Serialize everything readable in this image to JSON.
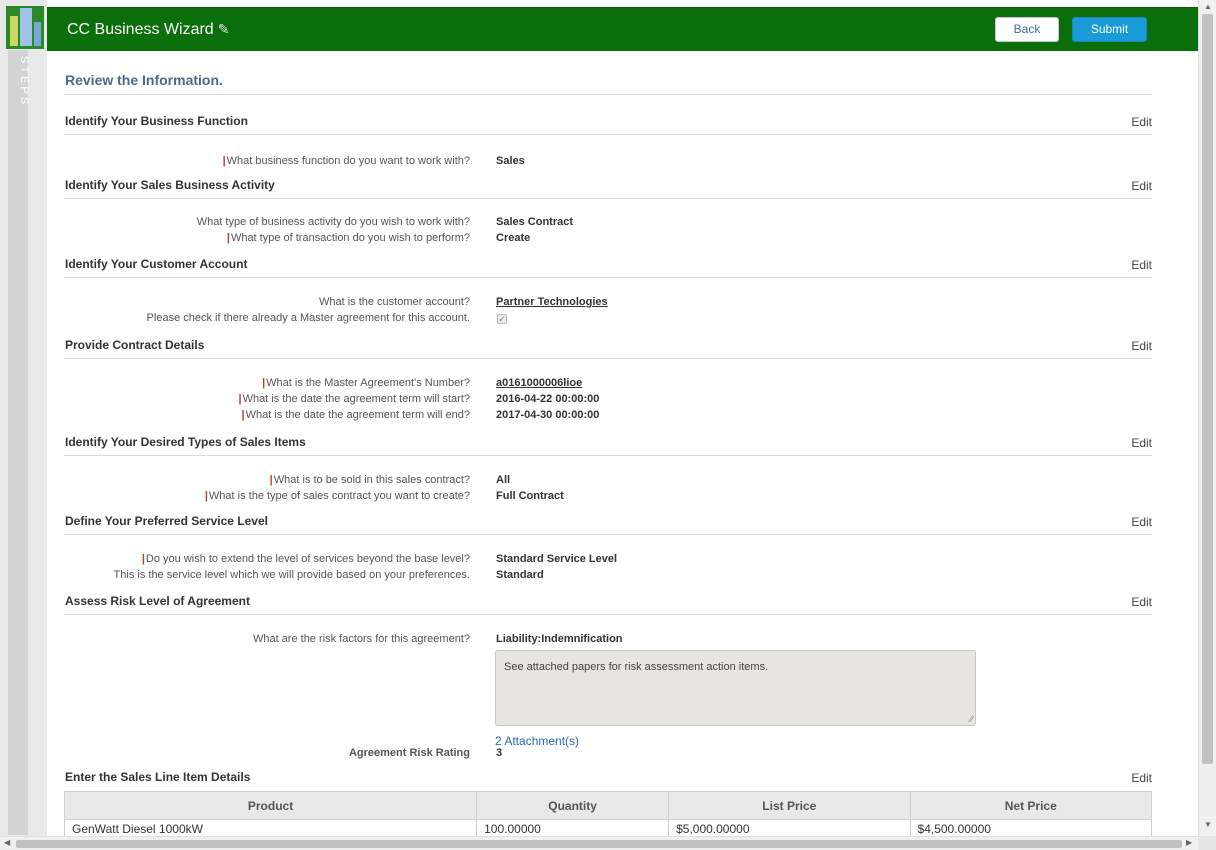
{
  "header": {
    "app_title": "CC Business Wizard",
    "back_label": "Back",
    "submit_label": "Submit"
  },
  "steps_rail": {
    "label": "STEPS"
  },
  "page_title": "Review the Information.",
  "edit_label": "Edit",
  "sections": [
    {
      "title": "Identify Your Business Function",
      "rows": [
        {
          "label": "What business function do you want to work with?",
          "required": true,
          "value": "Sales"
        }
      ]
    },
    {
      "title": "Identify Your Sales Business Activity",
      "rows": [
        {
          "label": "What type of business activity do you wish to work with?",
          "required": false,
          "value": "Sales Contract"
        },
        {
          "label": "What type of transaction do you wish to perform?",
          "required": true,
          "value": "Create"
        }
      ]
    },
    {
      "title": "Identify Your Customer Account",
      "rows": [
        {
          "label": "What is the customer account?",
          "required": false,
          "value": "Partner Technologies",
          "is_link": true
        },
        {
          "label": "Please check if there already a Master agreement for this account.",
          "required": false,
          "checkbox_checked": true
        }
      ]
    },
    {
      "title": "Provide Contract Details",
      "rows": [
        {
          "label": "What is the Master Agreement's Number?",
          "required": true,
          "value": "a0161000006lioe",
          "is_link": true
        },
        {
          "label": "What is the date the agreement term will start?",
          "required": true,
          "value": "2016-04-22 00:00:00"
        },
        {
          "label": "What is the date the agreement term will end?",
          "required": true,
          "value": "2017-04-30 00:00:00"
        }
      ]
    },
    {
      "title": "Identify Your Desired Types of Sales Items",
      "rows": [
        {
          "label": "What is to be sold in this sales contract?",
          "required": true,
          "value": "All"
        },
        {
          "label": "What is the type of sales contract you want to create?",
          "required": true,
          "value": "Full Contract"
        }
      ]
    },
    {
      "title": "Define Your Preferred Service Level",
      "rows": [
        {
          "label": "Do you wish to extend the level of services beyond the base level?",
          "required": true,
          "value": "Standard Service Level"
        },
        {
          "label": "This is the service level which we will provide based on your preferences.",
          "required": false,
          "value": "Standard"
        }
      ]
    },
    {
      "title": "Assess Risk Level of Agreement",
      "rows": [
        {
          "label": "What are the risk factors for this agreement?",
          "required": false,
          "value": "Liability:Indemnification"
        }
      ]
    },
    {
      "title": "Enter the Sales Line Item Details",
      "rows": []
    }
  ],
  "risk": {
    "notes": "See attached papers for risk assessment action items.",
    "attachments_link": "2 Attachment(s)",
    "rating_label": "Agreement Risk Rating",
    "rating_value": "3"
  },
  "line_items": {
    "columns": [
      "Product",
      "Quantity",
      "List Price",
      "Net Price"
    ],
    "rows": [
      [
        "GenWatt Diesel 1000kW",
        "100.00000",
        "$5,000.00000",
        "$4,500.00000"
      ]
    ]
  }
}
